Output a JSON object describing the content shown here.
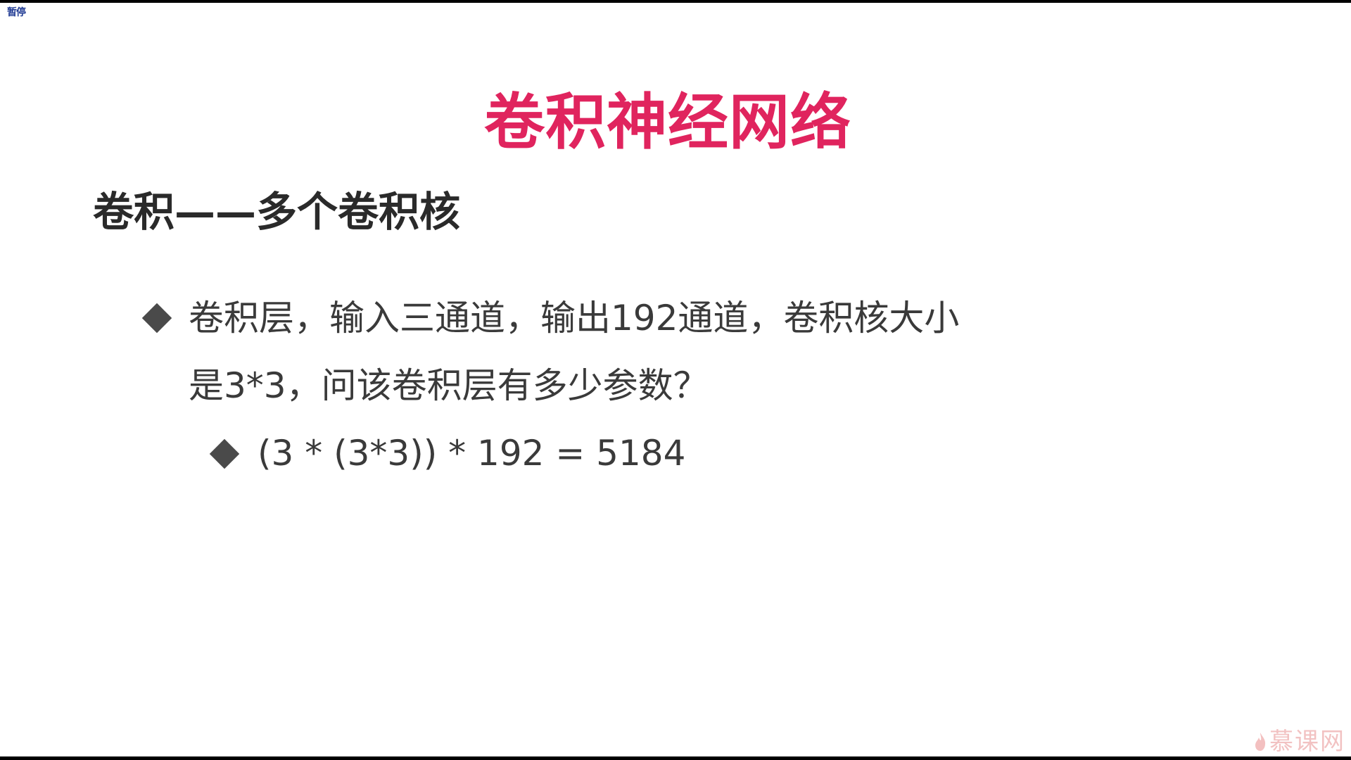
{
  "player": {
    "pause_label": "暂停"
  },
  "slide": {
    "title": "卷积神经网络",
    "subtitle": "卷积——多个卷积核",
    "bullets": [
      {
        "line1": "卷积层，输入三通道，输出192通道，卷积核大小",
        "line2": "是3*3，问该卷积层有多少参数？"
      },
      {
        "text": "(3 * (3*3)) * 192 = 5184"
      }
    ]
  },
  "watermark": {
    "text": "慕课网",
    "icon": "flame-logo-icon"
  },
  "colors": {
    "title": "#e0245e",
    "subtitle": "#2a2a2a",
    "body": "#3a3a3a",
    "bullet_marker": "#4a4a4a",
    "watermark": "#f0b8b8",
    "background": "#ffffff",
    "frame": "#000000"
  }
}
